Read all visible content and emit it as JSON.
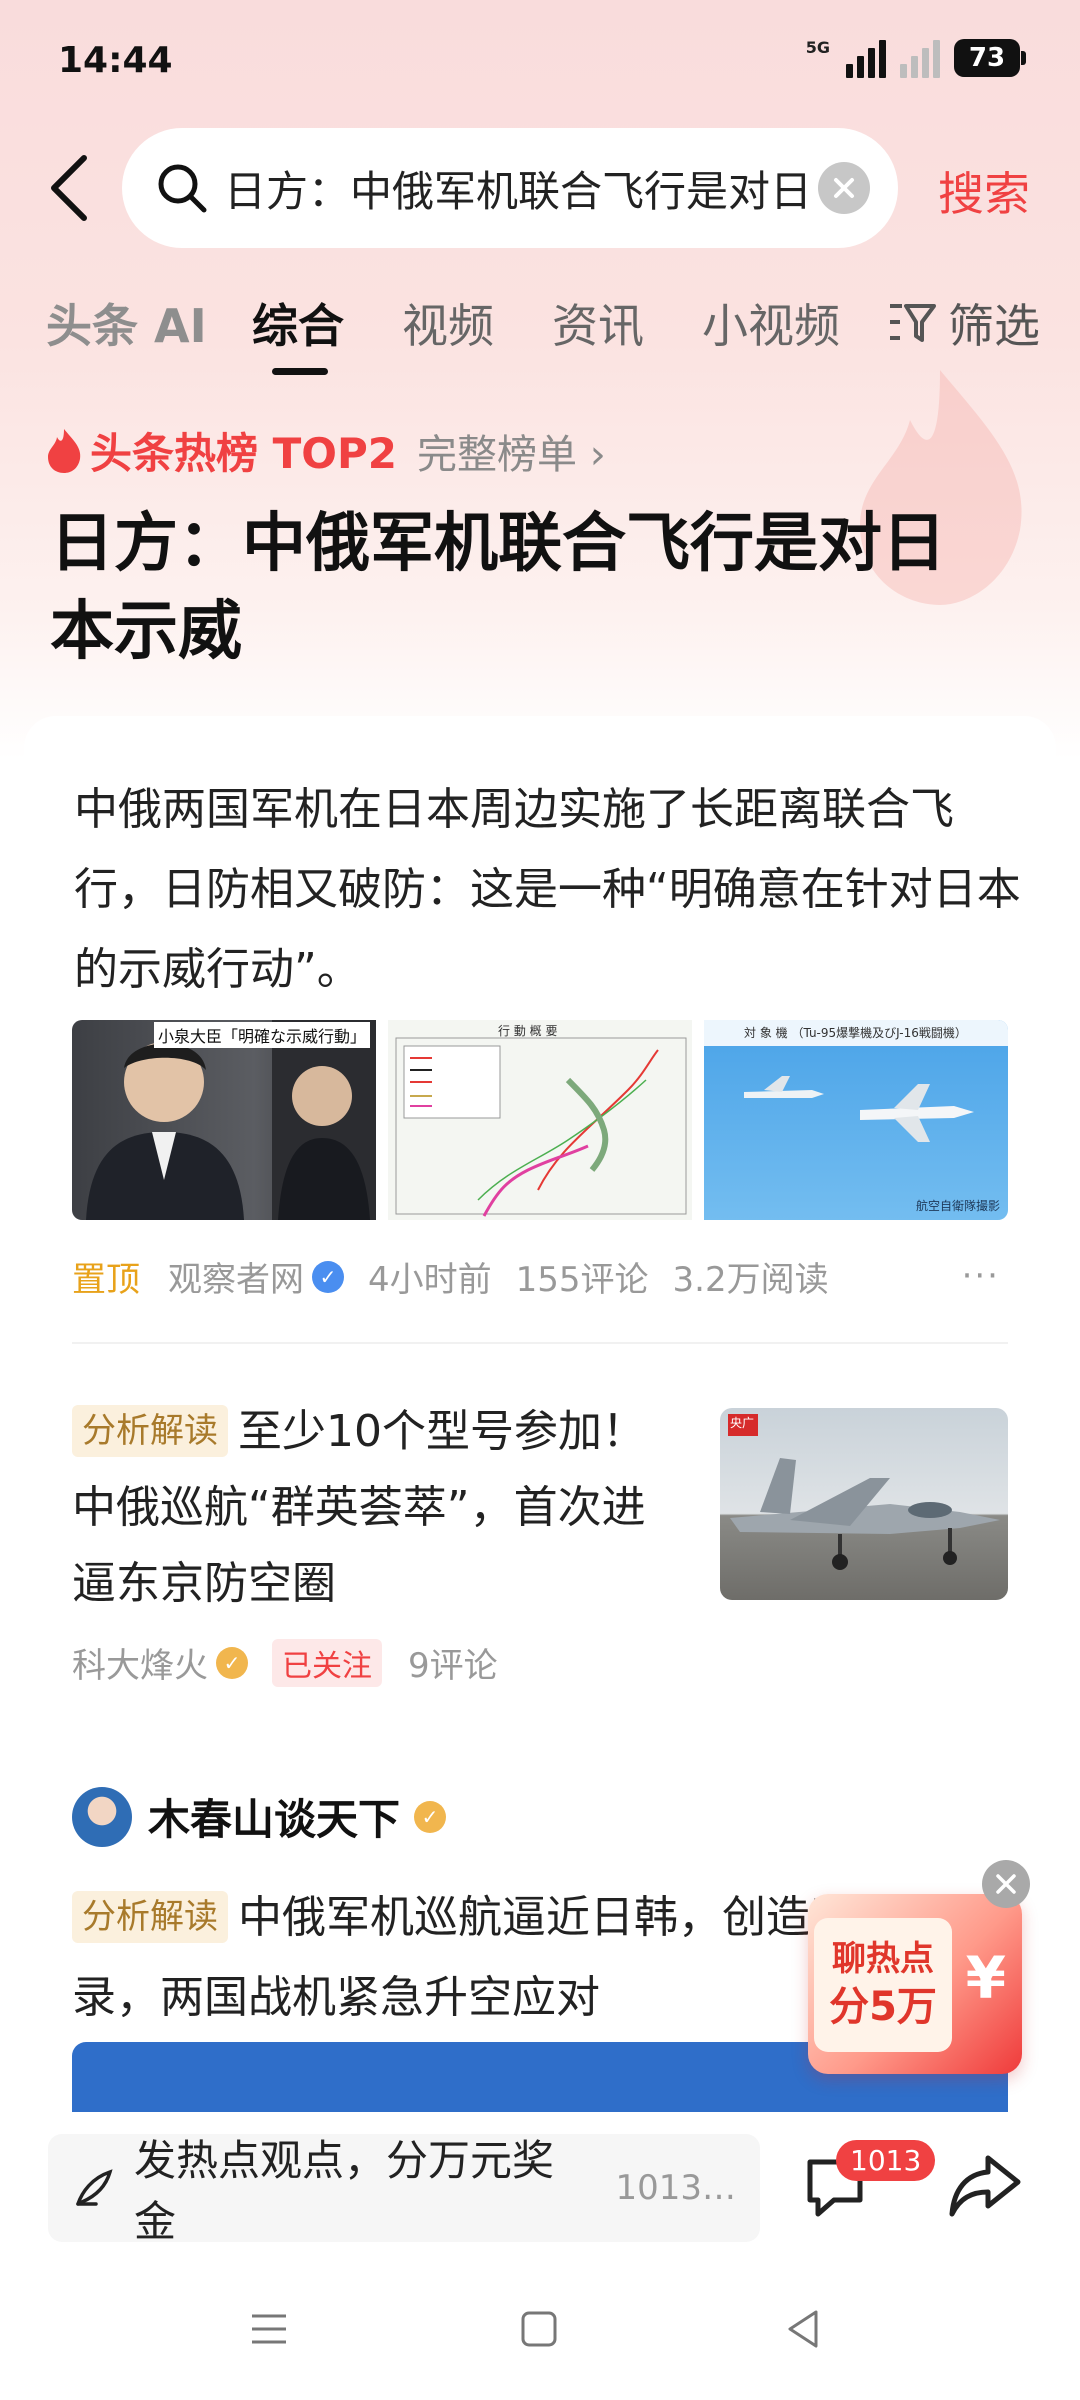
{
  "status": {
    "time": "14:44",
    "network": "5G",
    "battery": "73"
  },
  "search": {
    "query": "日方：中俄军机联合飞行是对日本示威",
    "button": "搜索"
  },
  "tabs": [
    "头条 AI",
    "综合",
    "视频",
    "资讯",
    "小视频"
  ],
  "active_tab": "综合",
  "filter_label": "筛选",
  "hot": {
    "label": "头条热榜 TOP2",
    "link": "完整榜单"
  },
  "headline": "日方：中俄军机联合飞行是对日本示威",
  "article1": {
    "summary": "中俄两国军机在日本周边实施了长距离联合飞行，日防相又破防：这是一种“明确意在针对日本的示威行动”。",
    "image1_caption": "小泉大臣「明確な示威行動」",
    "image2_caption": "行 動 概 要",
    "image3_caption": "対 象 機 （Tu-95爆撃機及びJ-16戦闘機）",
    "image3_credit": "航空自衛隊撮影",
    "pin": "置顶",
    "source": "观察者网",
    "time": "4小时前",
    "comments": "155评论",
    "reads": "3.2万阅读",
    "more": "···"
  },
  "article2": {
    "tag": "分析解读",
    "title": "至少10个型号参加！中俄巡航“群英荟萃”，首次进逼东京防空圈",
    "image_logo": "央广",
    "source": "科大烽火",
    "followed": "已关注",
    "comments": "9评论"
  },
  "article3": {
    "author": "木春山谈天下",
    "tag": "分析解读",
    "title": "中俄军机巡航逼近日韩，创造了三个纪录，两国战机紧急升空应对"
  },
  "promo": {
    "line1": "聊热点",
    "line2": "分5万",
    "symbol": "¥"
  },
  "bottom": {
    "comment_placeholder": "发热点观点，分万元奖金",
    "comment_count": "1013…",
    "badge": "1013"
  },
  "colors": {
    "accent": "#f04142",
    "pin": "#e8a21a",
    "tag_bg": "#fbf0dd"
  }
}
